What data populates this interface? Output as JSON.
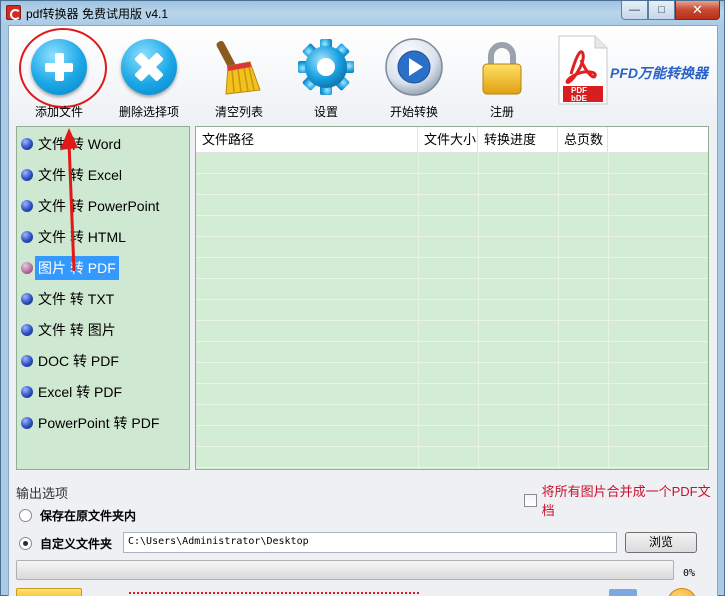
{
  "window": {
    "title": "pdf转换器 免费试用版 v4.1",
    "minimize": "—",
    "maximize": "□",
    "close": "✕"
  },
  "toolbar": {
    "add_file": "添加文件",
    "remove_selected": "删除选择项",
    "clear_list": "清空列表",
    "settings": "设置",
    "start_convert": "开始转换",
    "register": "注册",
    "brand": "PFD万能转换器",
    "pdf_badge_1": "PDF",
    "pdf_badge_2": "bDE"
  },
  "conversion_types": [
    "文件 转 Word",
    "文件 转 Excel",
    "文件 转 PowerPoint",
    "文件 转 HTML",
    "图片 转 PDF",
    "文件 转 TXT",
    "文件 转 图片",
    "DOC 转 PDF",
    "Excel 转 PDF",
    "PowerPoint 转 PDF"
  ],
  "selected_type_index": 4,
  "file_table": {
    "columns": [
      "文件路径",
      "文件大小",
      "转换进度",
      "总页数"
    ],
    "rows": []
  },
  "output": {
    "section_title": "输出选项",
    "merge_images_label": "将所有图片合并成一个PDF文档",
    "merge_images_checked": false,
    "option_original_folder": "保存在原文件夹内",
    "option_custom_folder": "自定义文件夹",
    "selected_option": "custom",
    "custom_path": "C:\\Users\\Administrator\\Desktop",
    "browse_label": "浏览"
  },
  "progress": {
    "value": 0,
    "label": "0%"
  },
  "colors": {
    "list_bg": "#d3ecd4",
    "selection": "#3399ff",
    "annotation_red": "#e01818",
    "brand_blue": "#2a63c8"
  }
}
